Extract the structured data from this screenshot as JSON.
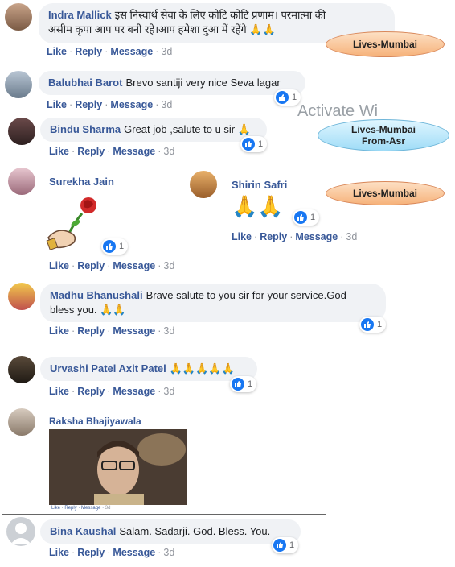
{
  "comments": [
    {
      "name": "Indra Mallick",
      "text": "इस निस्वार्थ सेवा के लिए कोटि कोटि प्रणाम। परमात्मा की",
      "text2": "असीम कृपा आप पर बनी रहे।आप हमेशा दुआ में रहेंगे",
      "emoji": "🙏🙏",
      "like": "Like",
      "reply": "Reply",
      "message": "Message",
      "time": "3d",
      "tag": "Lives-Mumbai"
    },
    {
      "name": "Balubhai Barot",
      "text": "Brevo santiji very nice Seva lagar",
      "like": "Like",
      "reply": "Reply",
      "message": "Message",
      "time": "3d",
      "count": "1"
    },
    {
      "name": "Bindu Sharma",
      "text": "Great job ,salute to u sir",
      "emoji": "🙏",
      "like": "Like",
      "reply": "Reply",
      "message": "Message",
      "time": "3d",
      "count": "1",
      "tag": "Lives-Mumbai From-Asr"
    },
    {
      "name": "Surekha Jain",
      "like": "Like",
      "reply": "Reply",
      "message": "Message",
      "time": "3d",
      "count": "1"
    },
    {
      "name": "Shirin Safri",
      "emoji": "🙏🙏",
      "like": "Like",
      "reply": "Reply",
      "message": "Message",
      "time": "3d",
      "count": "1",
      "tag": "Lives-Mumbai"
    },
    {
      "name": "Madhu Bhanushali",
      "text": "Brave salute to you sir for your service.God",
      "text2": "bless you.",
      "emoji": "🙏🙏",
      "like": "Like",
      "reply": "Reply",
      "message": "Message",
      "time": "3d",
      "count": "1"
    },
    {
      "name": "Urvashi Patel Axit Patel",
      "emoji": "🙏🙏🙏🙏🙏",
      "like": "Like",
      "reply": "Reply",
      "message": "Message",
      "time": "3d",
      "count": "1"
    },
    {
      "name": "Raksha Bhajiyawala",
      "like": "Like",
      "reply": "Reply",
      "message": "Message",
      "time": "3d"
    },
    {
      "name": "Bina Kaushal",
      "text": "Salam. Sadarji. God. Bless. You.",
      "like": "Like",
      "reply": "Reply",
      "message": "Message",
      "time": "3d",
      "count": "1"
    }
  ],
  "tags": {
    "mumbai": "Lives-Mumbai",
    "asr_line1": "Lives-Mumbai",
    "asr_line2": "From-Asr"
  },
  "watermark": "Activate Wi",
  "colors": {
    "link": "#385898",
    "bubble": "#f0f2f5",
    "like_icon": "#1877f2",
    "pill_orange": "#f6b27a",
    "pill_blue": "#9fdcf7"
  }
}
